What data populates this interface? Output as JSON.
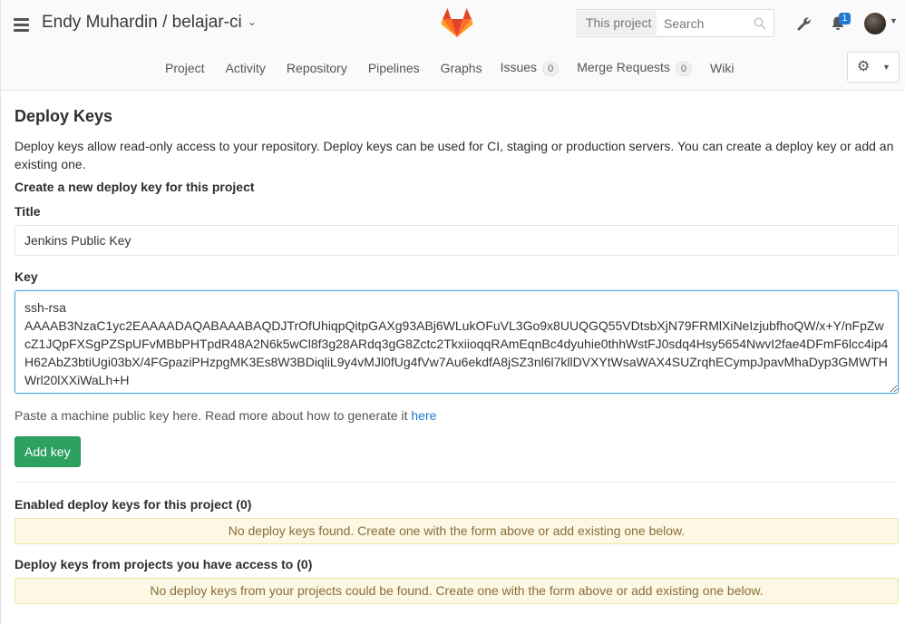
{
  "header": {
    "title": "Endy Muhardin / belajar-ci",
    "search": {
      "scope": "This project",
      "placeholder": "Search"
    },
    "notifications_count": "1"
  },
  "nav": {
    "items": [
      {
        "label": "Project"
      },
      {
        "label": "Activity"
      },
      {
        "label": "Repository"
      },
      {
        "label": "Pipelines"
      },
      {
        "label": "Graphs"
      },
      {
        "label": "Issues",
        "count": "0"
      },
      {
        "label": "Merge Requests",
        "count": "0"
      },
      {
        "label": "Wiki"
      }
    ]
  },
  "page": {
    "heading": "Deploy Keys",
    "description": "Deploy keys allow read-only access to your repository. Deploy keys can be used for CI, staging or production servers. You can create a deploy key or add an existing one.",
    "create_heading": "Create a new deploy key for this project",
    "title_label": "Title",
    "title_value": "Jenkins Public Key",
    "key_label": "Key",
    "key_value": "ssh-rsa\nAAAAB3NzaC1yc2EAAAADAQABAAABAQDJTrOfUhiqpQitpGAXg93ABj6WLukOFuVL3Go9x8UUQGQ55VDtsbXjN79FRMlXiNeIzjubfhoQW/x+Y/nFpZwcZ1JQpFXSgPZSpUFvMBbPHTpdR48A2N6k5wCl8f3g28ARdq3gG8Zctc2TkxiioqqRAmEqnBc4dyuhie0thhWstFJ0sdq4Hsy5654NwvI2fae4DFmF6lcc4ip4H62AbZ3btiUgi03bX/4FGpaziPHzpgMK3Es8W3BDiqliL9y4vMJl0fUg4fVw7Au6ekdfA8jSZ3nl6l7kllDVXYtWsaWAX4SUZrqhECympJpavMhaDyp3GMWTHWrl20lXXiWaLh+H",
    "hint_text": "Paste a machine public key here. Read more about how to generate it ",
    "hint_link": "here",
    "add_button": "Add key",
    "enabled_heading": "Enabled deploy keys for this project (0)",
    "enabled_notice": "No deploy keys found. Create one with the form above or add existing one below.",
    "access_heading": "Deploy keys from projects you have access to (0)",
    "access_notice": "No deploy keys from your projects could be found. Create one with the form above or add existing one below."
  }
}
